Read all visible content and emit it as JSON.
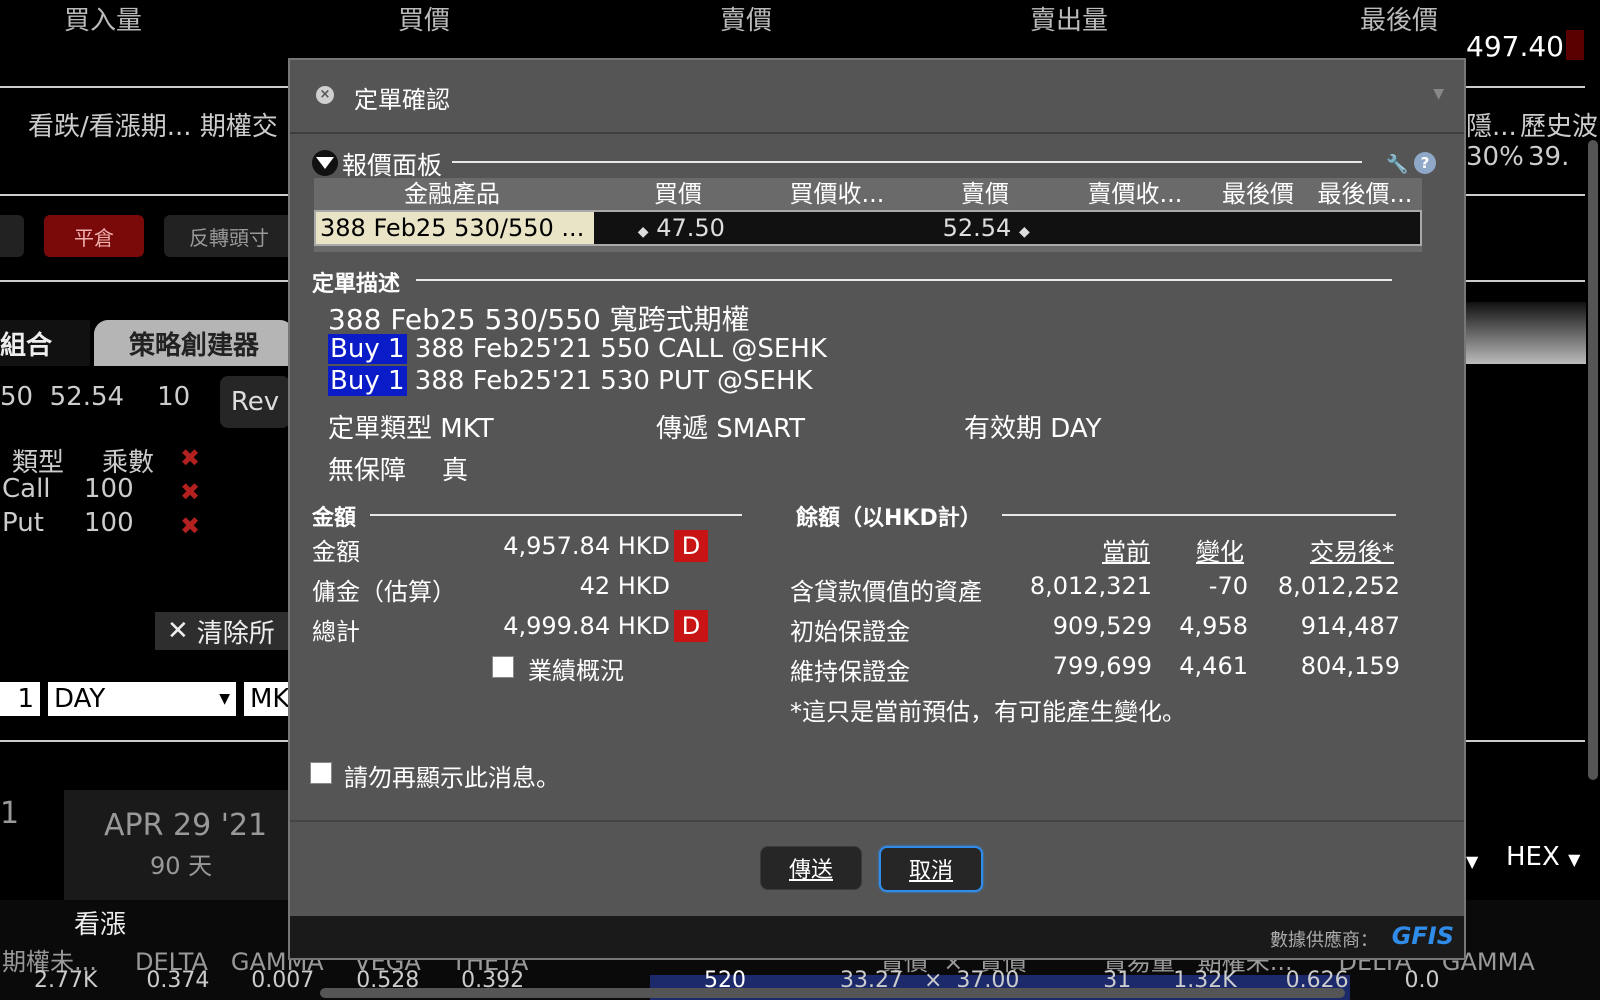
{
  "background": {
    "columns": [
      "買入量",
      "買價",
      "賣價",
      "賣出量",
      "最後價"
    ],
    "last_price": "497.40",
    "row_left": "看跌/看漲期... 期權交",
    "row_right_1": "隱...",
    "row_right_2": "歷史波",
    "row_right_3": "30%",
    "row_right_4": "39.",
    "btn_close": "平倉",
    "btn_reverse": "反轉頭寸",
    "tab_combo": "組合",
    "tab_strategy": "策略創建器",
    "leg_summary": "50  52.54    10",
    "rev_label": "Rev",
    "leg_headers": [
      "類型",
      "乘數"
    ],
    "legs": [
      {
        "type": "Call",
        "mult": "100"
      },
      {
        "type": "Put",
        "mult": "100"
      }
    ],
    "clear_label": "清除所",
    "qty": "1",
    "tif": "DAY",
    "order_type_short": "MK",
    "exp_left": "1",
    "exp_date": "APR 29 '21",
    "exp_days": "90 天",
    "right_dd1": "▼",
    "right_hex": "HEX",
    "bottom_call": "看漲",
    "bottom_headers": "期權未...     DELTA   GAMMA    VEGA    THETA",
    "bottom_right_headers": "賣價  ×  賣價          賣易量   期權未...      DELTA    GAMMA",
    "bottom_vals": "2.77K       0.374      0.007      0.528      0.392",
    "bottom_strike": "520",
    "bottom_right_vals": "33.27   ×  37.00            31      1.32K       0.626        0.0"
  },
  "dialog": {
    "title": "定單確認",
    "quote_panel": {
      "label": "報價面板",
      "headers": [
        "金融產品",
        "買價",
        "買價收...",
        "賣價",
        "賣價收...",
        "最後價",
        "最後價..."
      ],
      "row": {
        "instrument": "388 Feb25 530/550 ...",
        "bid": "47.50",
        "ask": "52.54"
      }
    },
    "order_desc": {
      "label": "定單描述",
      "title": "388 Feb25 530/550 寬跨式期權",
      "legs": [
        {
          "action": "Buy 1",
          "text": "388 Feb25'21 550 CALL @SEHK"
        },
        {
          "action": "Buy 1",
          "text": "388 Feb25'21 530 PUT @SEHK"
        }
      ],
      "order_type": "定單類型 MKT",
      "routing": "傳遞 SMART",
      "tif": "有效期 DAY",
      "unguaranteed_label": "無保障",
      "unguaranteed_value": "真"
    },
    "amount": {
      "label": "金額",
      "rows": [
        {
          "label": "金額",
          "value": "4,957.84 HKD",
          "badge": "D"
        },
        {
          "label": "傭金（估算）",
          "value": "42 HKD",
          "badge": ""
        },
        {
          "label": "總計",
          "value": "4,999.84 HKD",
          "badge": "D"
        }
      ],
      "performance_label": "業績概況"
    },
    "balance": {
      "label": "餘額（以HKD計）",
      "headers": [
        "當前",
        "變化",
        "交易後*"
      ],
      "rows": [
        {
          "label": "含貸款價值的資產",
          "current": "8,012,321",
          "change": "-70",
          "after": "8,012,252"
        },
        {
          "label": "初始保證金",
          "current": "909,529",
          "change": "4,958",
          "after": "914,487"
        },
        {
          "label": "維持保證金",
          "current": "799,699",
          "change": "4,461",
          "after": "804,159"
        }
      ],
      "note": "*這只是當前預估，有可能產生變化。"
    },
    "dont_show": "請勿再顯示此消息。",
    "send_label": "傳送",
    "cancel_label": "取消",
    "provider_label": "數據供應商：",
    "provider_name": "GFIS"
  }
}
